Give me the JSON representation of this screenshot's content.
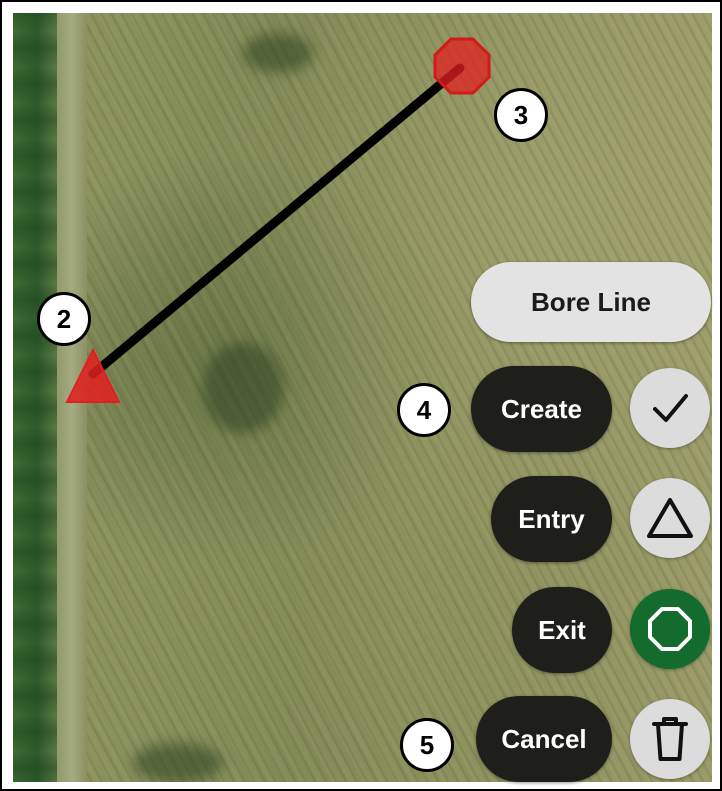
{
  "map": {
    "markers": {
      "entry_badge": "2",
      "exit_badge": "3"
    },
    "colors": {
      "marker": "#e02020",
      "bore_line": "#000000"
    }
  },
  "menu": {
    "title": "Bore Line",
    "actions": [
      {
        "label": "Create",
        "icon": "check-icon",
        "badge": "4"
      },
      {
        "label": "Entry",
        "icon": "triangle-icon"
      },
      {
        "label": "Exit",
        "icon": "octagon-icon",
        "active": true
      },
      {
        "label": "Cancel",
        "icon": "trash-icon",
        "badge": "5"
      }
    ],
    "colors": {
      "action_pill": "#1e1e1a",
      "title_pill": "#e3e3e3",
      "exit_active": "#136b2e"
    }
  }
}
